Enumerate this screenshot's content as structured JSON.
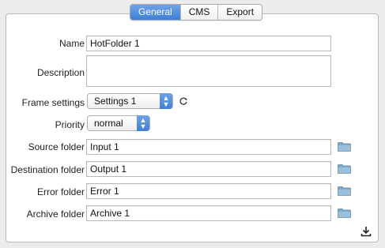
{
  "tabs": [
    {
      "label": "General",
      "active": true
    },
    {
      "label": "CMS",
      "active": false
    },
    {
      "label": "Export",
      "active": false
    }
  ],
  "form": {
    "name_label": "Name",
    "name_value": "HotFolder 1",
    "description_label": "Description",
    "description_value": "",
    "frame_settings_label": "Frame settings",
    "frame_settings_value": "Settings 1",
    "priority_label": "Priority",
    "priority_value": "normal",
    "source_folder_label": "Source folder",
    "source_folder_value": "Input 1",
    "destination_folder_label": "Destination folder",
    "destination_folder_value": "Output 1",
    "error_folder_label": "Error folder",
    "error_folder_value": "Error 1",
    "archive_folder_label": "Archive folder",
    "archive_folder_value": "Archive 1"
  },
  "icons": {
    "folder": "folder-icon",
    "refresh": "refresh-icon",
    "download": "download-icon"
  },
  "colors": {
    "accent": "#3f7fd6",
    "folder": "#7fa9c9"
  }
}
